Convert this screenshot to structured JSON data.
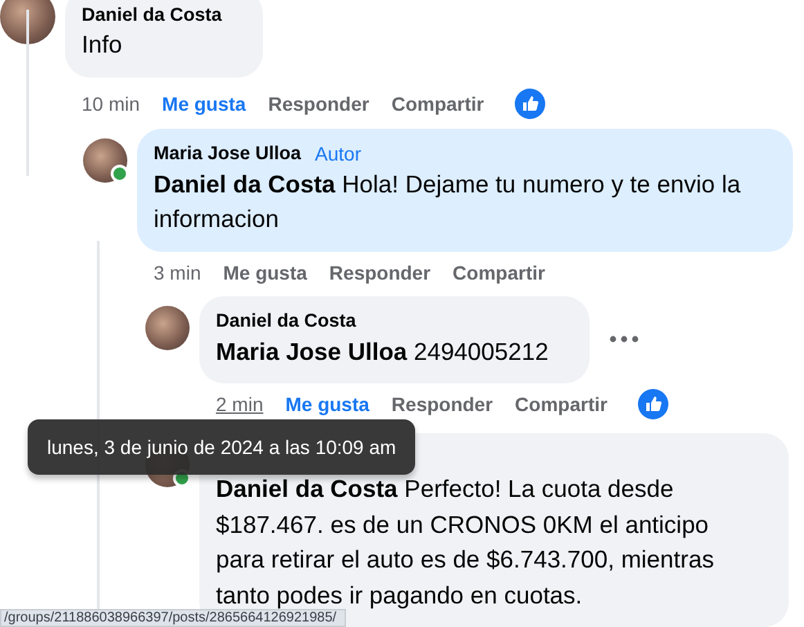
{
  "comments": [
    {
      "author": "Daniel da Costa",
      "body": "Info",
      "time": "10 min",
      "liked": true,
      "reaction": true,
      "highlighted": false,
      "hovered": false,
      "online": false,
      "actions": [
        "Me gusta",
        "Responder",
        "Compartir"
      ],
      "children": [
        {
          "author": "Maria Jose Ulloa",
          "badge": "Autor",
          "body": "**Daniel da Costa** Hola! Dejame tu numero y te envio la informacion",
          "time": "3 min",
          "liked": false,
          "reaction": false,
          "highlighted": true,
          "hovered": false,
          "online": true,
          "actions": [
            "Me gusta",
            "Responder",
            "Compartir"
          ],
          "children": [
            {
              "author": "Daniel da Costa",
              "body": "**Maria Jose Ulloa** 2494005212",
              "time": "2 min",
              "liked": true,
              "reaction": true,
              "highlighted": false,
              "hovered": true,
              "online": false,
              "actions": [
                "Me gusta",
                "Responder",
                "Compartir"
              ]
            },
            {
              "body": "**Daniel da Costa** Perfecto! La cuota desde $187.467. es de un CRONOS 0KM el anticipo para retirar el auto es de $6.743.700, mientras tanto podes ir pagando en cuotas.",
              "highlighted": false,
              "hovered": false,
              "online": true
            }
          ]
        }
      ]
    }
  ],
  "tooltip": "lunes, 3 de junio de 2024 a las 10:09 am",
  "status_bar": "/groups/211886038966397/posts/2865664126921985/"
}
